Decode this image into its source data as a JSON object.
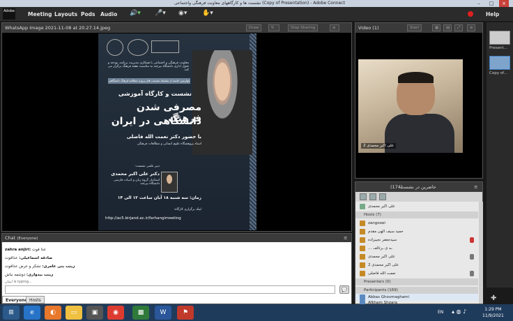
{
  "window": {
    "title": "نشست ها و کارگاههای معاونت فرهنگی واجتماعی (Copy of Presentation) - Adobe Connect"
  },
  "menubar": {
    "logo": "Adobe",
    "items": [
      "Meeting",
      "Layouts",
      "Pods",
      "Audio"
    ],
    "help": "Help"
  },
  "share_pod": {
    "title": "WhatsApp Image 2021-11-08 at 20.27.14.jpeg",
    "draw_label": "Draw",
    "stop_label": "Stop Sharing"
  },
  "poster": {
    "intro": "معاونت فرهنگی و اجتماعی با همکاری مدیریت برنامه، بودجه و تحول اداری دانشگاه بیرجند به مناسبت هفته فرهنگ برگزار می کند:",
    "band": "چهارمین جلسه از سلسله نشست های پروژه مطالعه فرهنگ دانشگاهی",
    "line1": "نشست و کارگاه آموزشی",
    "line2": "مصرفی شدن فرهنگ",
    "line3": "دانشگاهی در ایران",
    "speaker": "با حضور دکتر نعمت الله فاضلی",
    "speaker_title": "استاد پژوهشگاه علوم انسانی و مطالعات فرهنگی",
    "secretary_label": "دبیر علمی نشست:",
    "secretary": "دکتر علی اکبر محمدی",
    "secretary_title": "استادیار گروه زبان و ادبیات فارسی دانشگاه بیرجند",
    "time": "زمان: سه شنبه ۱۸ آبان ساعت ۱۲ الی ۱۴",
    "place": "لینک برگزاری کارگاه:",
    "url": "http://ac5.birjand.ac.ir/farhangimeeting"
  },
  "video_pod": {
    "title": "Video",
    "count": "(1)",
    "start_label": "Start",
    "caption": "علی اکبر محمدی 2"
  },
  "attendees_pod": {
    "title": "حاضرین در نشست",
    "count": "(174)",
    "me": "علی اکبر محمدی",
    "hosts_label": "Hosts (7)",
    "hosts": [
      "zangooei",
      "حمید سیف الهی مقدم",
      "سیدجعفر نجیبزاده",
      "... ـه ی ـرتالف",
      "علی اکبر محمدی",
      "علی اکبر محمدی 2",
      "نعمت الله فاضلی"
    ],
    "presenters_label": "Presenters (0)",
    "participants_label": "Participants (169)",
    "participants": [
      "Abbas Ghovmaghami",
      "Afkham Shoara"
    ]
  },
  "right_panel": {
    "layouts": [
      "Present...",
      "Copy of..."
    ]
  },
  "chat_pod": {
    "title": "Chat",
    "scope": "(Everyone)",
    "messages": [
      {
        "name": "zahra anjiri:",
        "text": "عذا قوت"
      },
      {
        "name": "صادقه اسماعیلی:",
        "text": "عذاقوت"
      },
      {
        "name": "زینب بنی عامری:",
        "text": "تشکر و عرض عذاقوت"
      },
      {
        "name": "زینب بیدواری:",
        "text": "دوشمه نباش"
      }
    ],
    "typing": "ایمان is typing...",
    "tabs": [
      "Everyone",
      "Hosts"
    ]
  },
  "taskbar": {
    "lang": "EN",
    "time": "1:29 PM",
    "date": "11/9/2021"
  }
}
